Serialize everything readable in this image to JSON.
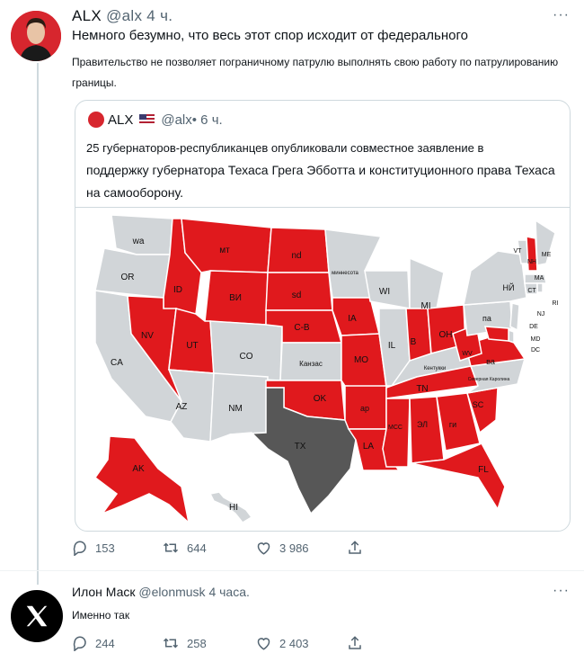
{
  "post": {
    "author_name": "ALX",
    "handle_time": "@alx 4 ч.",
    "more": "···",
    "line1": "Немного безумно, что весь этот спор исходит от федерального",
    "line2": "Правительство не позволяет пограничному патрулю выполнять свою работу по патрулированию границы.",
    "quote": {
      "author_name": "ALX",
      "handle_time": "@alx• 6 ч.",
      "text_line1": "25 губернаторов-республиканцев опубликовали совместное заявление в",
      "text_rest": "поддержку губернатора Техаса Грега Эбботта и конституционного права Техаса на самооборону."
    },
    "actions": {
      "replies": "153",
      "reposts": "644",
      "likes": "3 986"
    }
  },
  "reply": {
    "author_name": "Илон Маск",
    "handle_time": "@elonmusk 4 часа.",
    "more": "···",
    "text": "Именно так",
    "actions": {
      "replies": "244",
      "reposts": "258",
      "likes": "2 403"
    }
  },
  "map_labels": {
    "wa": "wa",
    "or": "OR",
    "ca": "CA",
    "id": "ID",
    "nv": "NV",
    "mt": "мт",
    "wy": "ВИ",
    "ut": "UT",
    "az": "AZ",
    "co": "CO",
    "nm": "NM",
    "nd": "nd",
    "sd": "sd",
    "ne": "С-В",
    "ks": "Канзас",
    "ok": "OK",
    "tx": "TX",
    "mn": "миннесота",
    "ia": "IA",
    "mo": "MO",
    "ar": "ар",
    "la": "LA",
    "wi": "WI",
    "il": "IL",
    "mi": "MI",
    "in": "В",
    "oh": "OH",
    "ky": "Кентукки",
    "tn": "TN",
    "ms": "МСС",
    "al": "ЭЛ",
    "ga": "ги",
    "fl": "FL",
    "sc": "SC",
    "nc": "Северная Каролина",
    "va": "ва",
    "wv": "WV",
    "pa": "па",
    "ny": "НЙ",
    "vt": "VT",
    "nh": "NH",
    "me": "ME",
    "ma": "МА",
    "ct": "CT",
    "ri": "RI",
    "nj": "NJ",
    "de": "DE",
    "md": "MD",
    "dc": "DC",
    "ak": "AK",
    "hi": "HI"
  },
  "colors": {
    "red": "#e0191d",
    "gray": "#d1d5d8",
    "texas": "#575757",
    "border": "#ffffff"
  }
}
